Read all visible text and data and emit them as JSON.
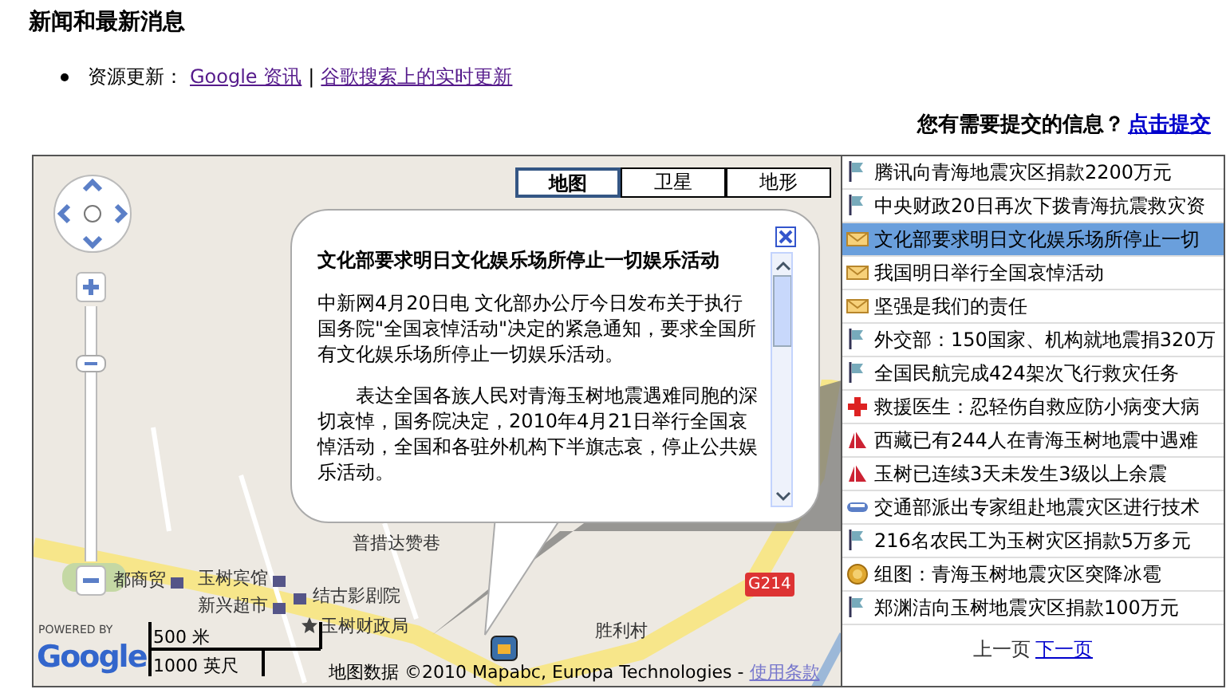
{
  "page_title": "新闻和最新消息",
  "resources": {
    "label": "资源更新：",
    "links": [
      "Google 资讯",
      "谷歌搜索上的实时更新"
    ],
    "separator": "|"
  },
  "submit": {
    "prompt": "您有需要提交的信息？",
    "link": "点击提交"
  },
  "map": {
    "zoom": {
      "level": 0.8
    },
    "map_types": [
      {
        "label": "地图",
        "selected": true
      },
      {
        "label": "卫星",
        "selected": false
      },
      {
        "label": "地形",
        "selected": false
      }
    ],
    "labels": [
      {
        "text": "普措达赞巷",
        "kind": "street"
      },
      {
        "text": "都商贸",
        "kind": "shop"
      },
      {
        "text": "玉树宾馆",
        "kind": "hotel"
      },
      {
        "text": "新兴超市",
        "kind": "shop"
      },
      {
        "text": "结古影剧院",
        "kind": "cinema"
      },
      {
        "text": "玉树财政局",
        "kind": "office"
      },
      {
        "text": "胜利村",
        "kind": "place"
      },
      {
        "text": "G214",
        "kind": "highway"
      }
    ],
    "info_window": {
      "title": "文化部要求明日文化娱乐场所停止一切娱乐活动",
      "paragraphs": [
        "中新网4月20日电 文化部办公厅今日发布关于执行国务院\"全国哀悼活动\"决定的紧急通知，要求全国所有文化娱乐场所停止一切娱乐活动。",
        "表达全国各族人民对青海玉树地震遇难同胞的深切哀悼，国务院决定，2010年4月21日举行全国哀悼活动，全国和各驻外机构下半旗志哀，停止公共娱乐活动。"
      ]
    },
    "powered_by": "POWERED BY",
    "logo": "Google",
    "scale": [
      "500 米",
      "1000 英尺"
    ],
    "attribution": {
      "text": "地图数据 ©2010 Mapabc, Europa Technologies -",
      "link": "使用条款"
    }
  },
  "news_list": {
    "items": [
      {
        "kind": "flag",
        "title": "腾讯向青海地震灾区捐款2200万元",
        "selected": false
      },
      {
        "kind": "flag",
        "title": "中央财政20日再次下拨青海抗震救灾资",
        "selected": false
      },
      {
        "kind": "mail",
        "title": "文化部要求明日文化娱乐场所停止一切",
        "selected": true
      },
      {
        "kind": "mail",
        "title": "我国明日举行全国哀悼活动",
        "selected": false
      },
      {
        "kind": "mail",
        "title": "坚强是我们的责任",
        "selected": false
      },
      {
        "kind": "flag",
        "title": "外交部：150国家、机构就地震捐320万",
        "selected": false
      },
      {
        "kind": "flag",
        "title": "全国民航完成424架次飞行救灾任务",
        "selected": false
      },
      {
        "kind": "cross",
        "title": "救援医生：忍轻伤自救应防小病变大病",
        "selected": false
      },
      {
        "kind": "tent",
        "title": "西藏已有244人在青海玉树地震中遇难",
        "selected": false
      },
      {
        "kind": "tent",
        "title": "玉树已连续3天未发生3级以上余震",
        "selected": false
      },
      {
        "kind": "bus",
        "title": "交通部派出专家组赴地震灾区进行技术",
        "selected": false
      },
      {
        "kind": "flag",
        "title": "216名农民工为玉树灾区捐款5万多元",
        "selected": false
      },
      {
        "kind": "medal",
        "title": "组图：青海玉树地震灾区突降冰雹",
        "selected": false
      },
      {
        "kind": "flag",
        "title": "郑渊洁向玉树地震灾区捐款100万元",
        "selected": false
      }
    ],
    "pagination": {
      "prev": "上一页",
      "next": "下一页"
    }
  }
}
